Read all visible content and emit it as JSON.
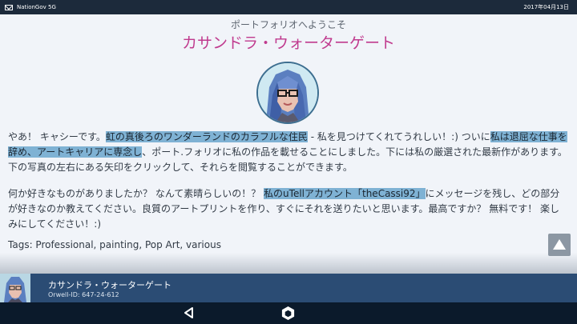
{
  "status_bar": {
    "carrier": "NationGov 5G",
    "date": "2017年04月13日"
  },
  "page": {
    "welcome": "ポートフォリオへようこそ",
    "name": "カサンドラ・ウォーターゲート",
    "intro": {
      "t1": "やあ！ キャシーです。",
      "h1": "虹の真後ろのワンダーランドのカラフルな住民",
      "t2": " - 私を見つけてくれてうれしい！:) ついに",
      "h2": "私は退屈な仕事を辞め、アートキャリアに専念し",
      "t3": "、ポート.フォリオに私の作品を載せることにしました。下には私の厳選された最新作があります。下の写真の左右にある矢印をクリックして、それらを閲覧することができます。"
    },
    "second": {
      "t1": "何か好きなものがありましたか？ なんて素晴らしいの！？ ",
      "h1": "私のuTellアカウント「theCassi92」",
      "t2": "にメッセージを残し、どの部分が好きなのか教えてください。良質のアートプリントを作り、すぐにそれを送りたいと思います。最高ですか？ 無料です！ 楽しみにしてください！:)"
    },
    "tags": "Tags: Professional, painting, Pop Art, various"
  },
  "profile": {
    "name": "カサンドラ・ウォーターゲート",
    "id": "Orwell-ID: 647-24-612"
  },
  "icons": {
    "mail": "mail-icon",
    "back": "back-icon",
    "home": "home-hexagon-icon",
    "scroll_top": "arrow-up-icon"
  },
  "colors": {
    "title_accent": "#c03a8e",
    "highlight": "#7fb2d4",
    "profile_bar": "#2b4c74",
    "nav_bar": "#0b1a2b",
    "status_bar": "#1c2a3b"
  }
}
